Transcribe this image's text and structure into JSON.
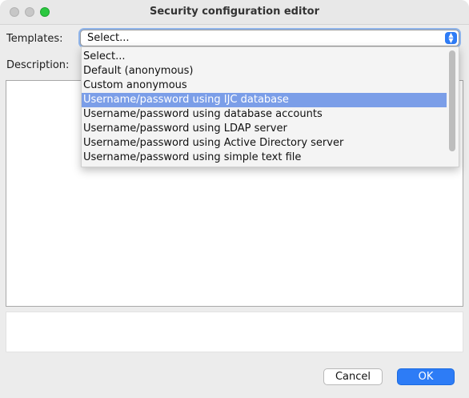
{
  "window": {
    "title": "Security configuration editor"
  },
  "form": {
    "templates_label": "Templates:",
    "description_label": "Description:",
    "selected_template": "Select..."
  },
  "dropdown": {
    "options": [
      "Select...",
      "Default (anonymous)",
      "Custom anonymous",
      "Username/password using IJC database",
      "Username/password using database accounts",
      "Username/password using LDAP server",
      "Username/password using Active Directory server",
      "Username/password using simple text file"
    ],
    "highlighted_index": 3
  },
  "buttons": {
    "cancel": "Cancel",
    "ok": "OK"
  },
  "colors": {
    "accent": "#2d7cf6",
    "highlight": "#7b9ee8"
  }
}
